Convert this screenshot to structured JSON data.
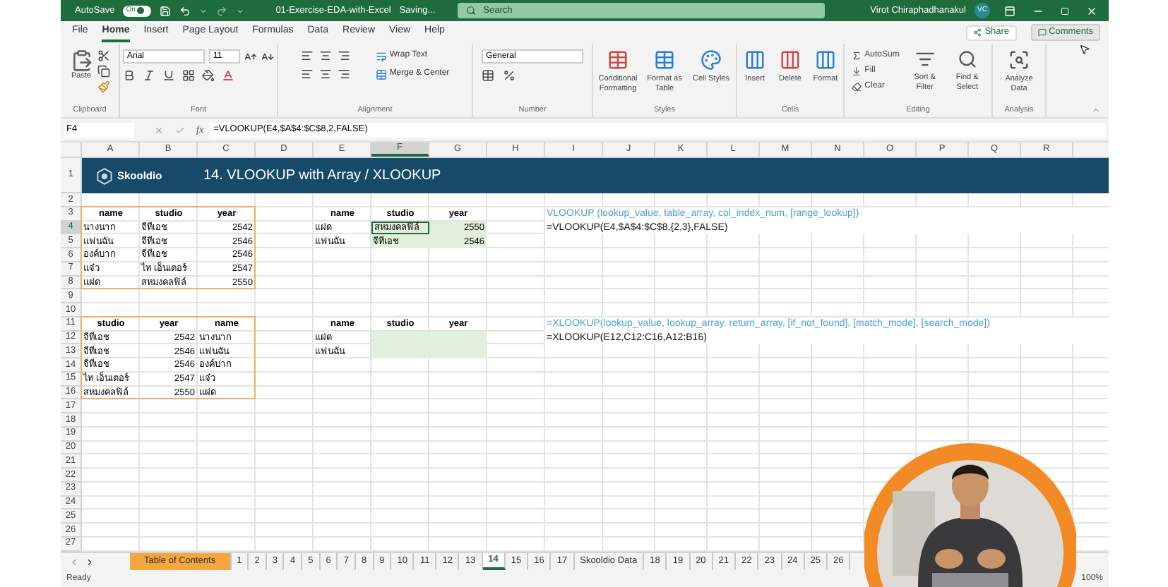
{
  "title_bar": {
    "autosave_label": "AutoSave",
    "autosave": {
      "label": "On",
      "on": true
    },
    "file_name": "01-Exercise-EDA-with-Excel",
    "save_status": "Saving...",
    "search": {
      "placeholder": "Search"
    },
    "user_name": "Virot Chiraphadhanakul",
    "avatar": "VC"
  },
  "ribbon_tabs": [
    {
      "label": "File",
      "selected": false
    },
    {
      "label": "Home",
      "selected": true
    },
    {
      "label": "Insert",
      "selected": false
    },
    {
      "label": "Page Layout",
      "selected": false
    },
    {
      "label": "Formulas",
      "selected": false
    },
    {
      "label": "Data",
      "selected": false
    },
    {
      "label": "Review",
      "selected": false
    },
    {
      "label": "View",
      "selected": false
    },
    {
      "label": "Help",
      "selected": false
    }
  ],
  "share_button": "Share",
  "comments_button": "Comments",
  "ribbon_groups": [
    {
      "label": "Clipboard",
      "kind": "clipboard",
      "buttons": [
        "Paste"
      ]
    },
    {
      "label": "Font",
      "kind": "font",
      "font": "Arial",
      "size": "11"
    },
    {
      "label": "Alignment",
      "kind": "alignment",
      "buttons": [
        "Wrap Text",
        "Merge & Center"
      ]
    },
    {
      "label": "Number",
      "kind": "number",
      "format": "General"
    },
    {
      "label": "Styles",
      "kind": "large",
      "buttons": [
        "Conditional Formatting",
        "Format as Table",
        "Cell Styles"
      ]
    },
    {
      "label": "Cells",
      "kind": "large",
      "buttons": [
        "Insert",
        "Delete",
        "Format"
      ]
    },
    {
      "label": "Editing",
      "kind": "editing",
      "small": [
        "AutoSum",
        "Fill",
        "Clear"
      ],
      "buttons": [
        "Sort & Filter",
        "Find & Select"
      ]
    },
    {
      "label": "Analysis",
      "kind": "large",
      "buttons": [
        "Analyze Data"
      ]
    }
  ],
  "formula_bar": {
    "name_box": "F4",
    "function_label": "fx",
    "formula": "=VLOOKUP(E4,$A$4:$C$8,2,FALSE)"
  },
  "sheet": {
    "columns": [
      "A",
      "B",
      "C",
      "D",
      "E",
      "F",
      "G",
      "H",
      "I",
      "J",
      "K",
      "L",
      "M",
      "N",
      "O",
      "P",
      "Q",
      "R"
    ],
    "rows": [
      "1",
      "2",
      "3",
      "4",
      "5",
      "6",
      "7",
      "8",
      "9",
      "10",
      "11",
      "12",
      "13",
      "14",
      "15",
      "16",
      "17",
      "18",
      "19",
      "20",
      "21",
      "22",
      "23",
      "24",
      "25",
      "26",
      "27"
    ],
    "banner": {
      "logo": "Skooldio",
      "title": "14. VLOOKUP with Array / XLOOKUP"
    },
    "blocks": [
      {
        "kind": "table",
        "bordered": true,
        "header": [
          "name",
          "studio",
          "year"
        ],
        "numeric": [
          false,
          false,
          true
        ],
        "filled": [
          false,
          false,
          false
        ],
        "rows": [
          [
            {
              "text": "นางนาก",
              "selected": false
            },
            {
              "text": "จีทีเอช",
              "selected": false
            },
            {
              "text": "2542",
              "selected": false
            }
          ],
          [
            {
              "text": "แฟนฉัน",
              "selected": false
            },
            {
              "text": "จีทีเอช",
              "selected": false
            },
            {
              "text": "2546",
              "selected": false
            }
          ],
          [
            {
              "text": "องค์บาก",
              "selected": false
            },
            {
              "text": "จีทีเอช",
              "selected": false
            },
            {
              "text": "2546",
              "selected": false
            }
          ],
          [
            {
              "text": "แจ๋ว",
              "selected": false
            },
            {
              "text": "ไท เอ็นเตอร์",
              "selected": false
            },
            {
              "text": "2547",
              "selected": false
            }
          ],
          [
            {
              "text": "แฝด",
              "selected": false
            },
            {
              "text": "สหมงคลฟิล์",
              "selected": false
            },
            {
              "text": "2550",
              "selected": false
            }
          ]
        ]
      },
      {
        "kind": "table",
        "bordered": false,
        "header": [
          "name",
          "studio",
          "year"
        ],
        "numeric": [
          false,
          false,
          true
        ],
        "filled": [
          false,
          true,
          true
        ],
        "rows": [
          [
            {
              "text": "แฝด",
              "selected": false
            },
            {
              "text": "สหมงคลฟิล์",
              "selected": true
            },
            {
              "text": "2550",
              "selected": false
            }
          ],
          [
            {
              "text": "แฟนฉัน",
              "selected": false
            },
            {
              "text": "จีทีเอช",
              "selected": false
            },
            {
              "text": "2546",
              "selected": false
            }
          ]
        ]
      },
      {
        "kind": "note",
        "lines": [
          {
            "kind": "hint",
            "text": "VLOOKUP (lookup_value, table_array, col_index_num, [range_lookup])"
          },
          {
            "kind": "formula",
            "text": "=VLOOKUP(E4,$A$4:$C$8,{2,3},FALSE)"
          }
        ]
      },
      {
        "kind": "table",
        "bordered": true,
        "header": [
          "studio",
          "year",
          "name"
        ],
        "numeric": [
          false,
          true,
          false
        ],
        "filled": [
          false,
          false,
          false
        ],
        "rows": [
          [
            {
              "text": "จีทีเอช",
              "selected": false
            },
            {
              "text": "2542",
              "selected": false
            },
            {
              "text": "นางนาก",
              "selected": false
            }
          ],
          [
            {
              "text": "จีทีเอช",
              "selected": false
            },
            {
              "text": "2546",
              "selected": false
            },
            {
              "text": "แฟนฉัน",
              "selected": false
            }
          ],
          [
            {
              "text": "จีทีเอช",
              "selected": false
            },
            {
              "text": "2546",
              "selected": false
            },
            {
              "text": "องค์บาก",
              "selected": false
            }
          ],
          [
            {
              "text": "ไท เอ็นเตอร์",
              "selected": false
            },
            {
              "text": "2547",
              "selected": false
            },
            {
              "text": "แจ๋ว",
              "selected": false
            }
          ],
          [
            {
              "text": "สหมงคลฟิล์",
              "selected": false
            },
            {
              "text": "2550",
              "selected": false
            },
            {
              "text": "แฝด",
              "selected": false
            }
          ]
        ]
      },
      {
        "kind": "table",
        "bordered": false,
        "header": [
          "name",
          "studio",
          "year"
        ],
        "numeric": [
          false,
          false,
          true
        ],
        "filled": [
          false,
          true,
          true
        ],
        "rows": [
          [
            {
              "text": "แฝด",
              "selected": false
            }
          ],
          [
            {
              "text": "แฟนฉัน",
              "selected": false
            }
          ]
        ]
      },
      {
        "kind": "note",
        "lines": [
          {
            "kind": "hint",
            "text": "=XLOOKUP(lookup_value, lookup_array, return_array, [if_not_found], [match_mode], [search_mode])"
          },
          {
            "kind": "formula",
            "text": "=XLOOKUP(E12,C12:C16,A12:B16)"
          }
        ]
      }
    ]
  },
  "sheet_tabs": [
    {
      "label": "Table of Contents",
      "selected": false,
      "color": "#f4a640"
    },
    {
      "label": "1",
      "selected": false
    },
    {
      "label": "2",
      "selected": false
    },
    {
      "label": "3",
      "selected": false
    },
    {
      "label": "4",
      "selected": false
    },
    {
      "label": "5",
      "selected": false
    },
    {
      "label": "6",
      "selected": false
    },
    {
      "label": "7",
      "selected": false
    },
    {
      "label": "8",
      "selected": false
    },
    {
      "label": "9",
      "selected": false
    },
    {
      "label": "10",
      "selected": false
    },
    {
      "label": "11",
      "selected": false
    },
    {
      "label": "12",
      "selected": false
    },
    {
      "label": "13",
      "selected": false
    },
    {
      "label": "14",
      "selected": true
    },
    {
      "label": "15",
      "selected": false
    },
    {
      "label": "16",
      "selected": false
    },
    {
      "label": "17",
      "selected": false
    },
    {
      "label": "Skooldio Data",
      "selected": false
    },
    {
      "label": "18",
      "selected": false
    },
    {
      "label": "19",
      "selected": false
    },
    {
      "label": "20",
      "selected": false
    },
    {
      "label": "21",
      "selected": false
    },
    {
      "label": "22",
      "selected": false
    },
    {
      "label": "23",
      "selected": false
    },
    {
      "label": "24",
      "selected": false
    },
    {
      "label": "25",
      "selected": false
    },
    {
      "label": "26",
      "selected": false
    }
  ],
  "status_bar": {
    "status": "Ready",
    "zoom": "100%"
  }
}
